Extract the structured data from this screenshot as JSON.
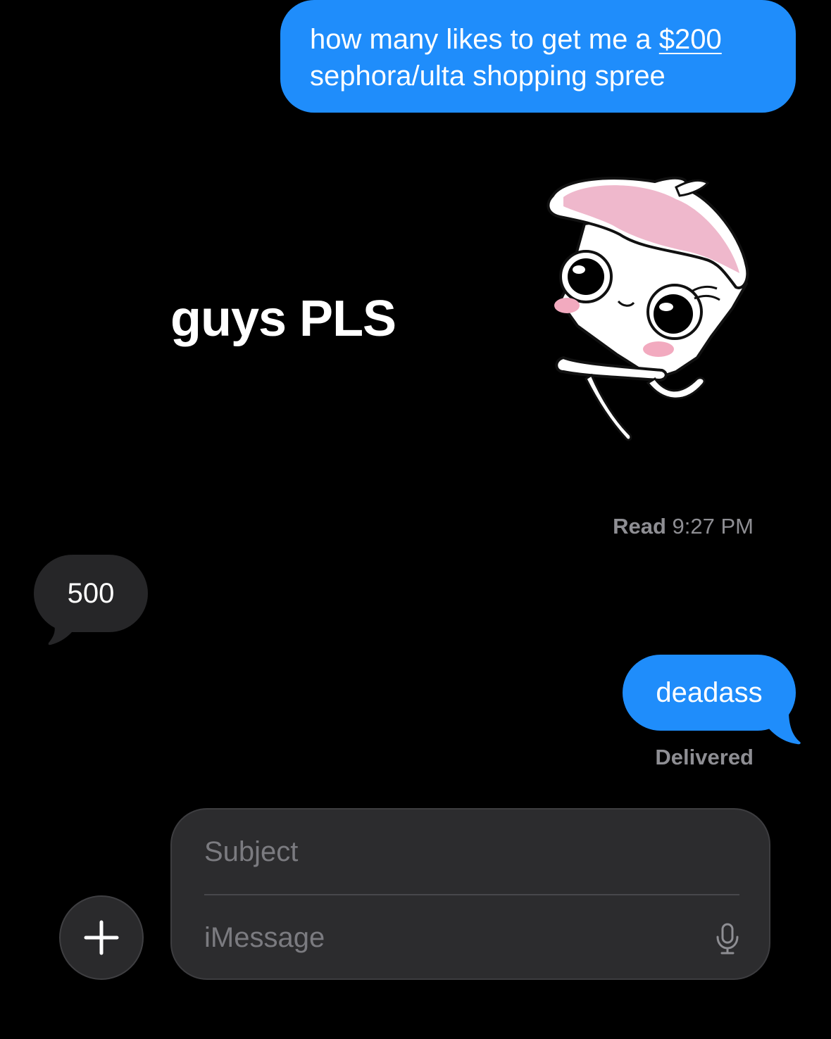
{
  "messages": {
    "outgoing_1": {
      "line1_before_price": "how many likes to get me a ",
      "price": "$200",
      "line2": "sephora/ulta shopping spree"
    },
    "sticker": {
      "text": "guys PLS",
      "icon": "cartoon-character-sticker"
    },
    "read_receipt": {
      "label": "Read",
      "time": "9:27 PM"
    },
    "incoming_1": {
      "text": "500"
    },
    "outgoing_2": {
      "text": "deadass",
      "status": "Delivered"
    }
  },
  "compose": {
    "subject_placeholder": "Subject",
    "message_placeholder": "iMessage",
    "plus_icon": "plus-icon",
    "mic_icon": "microphone-icon"
  },
  "colors": {
    "background": "#000000",
    "outgoing_bubble": "#1f8dfb",
    "incoming_bubble": "#262628",
    "receipt_text": "#8e8e93",
    "compose_bg": "#2c2c2e"
  }
}
